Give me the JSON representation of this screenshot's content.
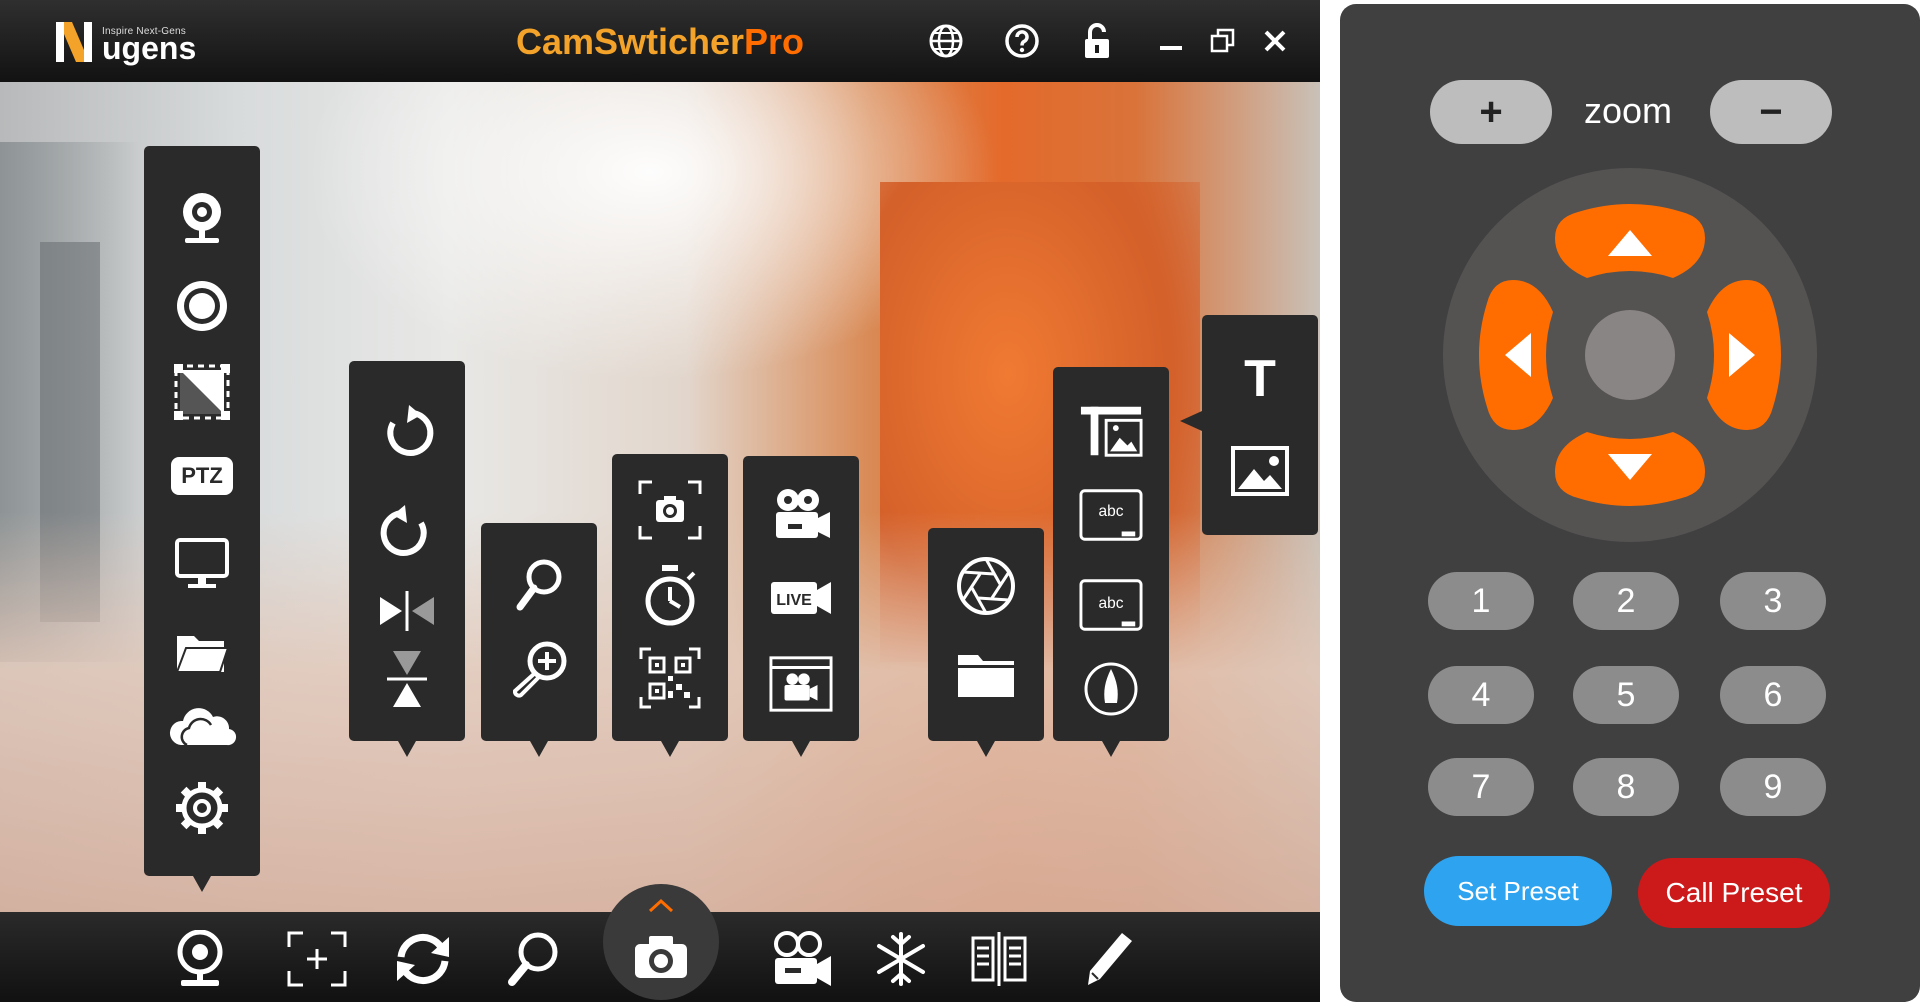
{
  "colors": {
    "title_orange": "#f3a22a",
    "title_pro": "#ff6d00",
    "dpad_orange": "#ff6d00",
    "set_preset_blue": "#2ea4f0",
    "call_preset_red": "#cc1a1a"
  },
  "titlebar": {
    "logo_tagline": "Inspire Next-Gens",
    "logo_word": "ugens",
    "title_main": "CamSwticher",
    "title_pro": "Pro",
    "icons": [
      "globe-icon",
      "help-icon",
      "unlock-icon",
      "minimize-icon",
      "restore-icon",
      "close-icon"
    ]
  },
  "toolbar_camera": {
    "ptz_label": "PTZ",
    "icons": [
      "webcam-icon",
      "lens-icon",
      "crop-icon",
      "ptz-icon",
      "monitor-icon",
      "folder-icon",
      "cloud-icon",
      "gear-icon"
    ]
  },
  "toolbar_rotate": {
    "icons": [
      "rotate-ccw-icon",
      "rotate-cw-icon",
      "flip-horizontal-icon",
      "flip-vertical-icon"
    ]
  },
  "toolbar_zoom": {
    "icons": [
      "magnifier-icon",
      "zoom-in-icon"
    ]
  },
  "toolbar_capture": {
    "icons": [
      "snapshot-icon",
      "timer-icon",
      "qr-code-icon"
    ]
  },
  "toolbar_video": {
    "live_label": "LIVE",
    "icons": [
      "video-camera-icon",
      "live-icon",
      "video-window-icon"
    ]
  },
  "toolbar_files": {
    "icons": [
      "aperture-icon",
      "folder-icon"
    ]
  },
  "toolbar_overlay": {
    "abc_label": "abc",
    "icons": [
      "text-image-icon",
      "text-board-icon",
      "text-board-2-icon",
      "pen-tip-icon"
    ]
  },
  "toolbar_insert": {
    "text_label": "T",
    "icons": [
      "text-icon",
      "image-icon"
    ]
  },
  "bottombar": {
    "icons": [
      "webcam-icon",
      "focus-frame-icon",
      "switch-icon",
      "magnifier-icon",
      "camera-icon",
      "video-camera-icon",
      "snowflake-icon",
      "compare-icon",
      "pencil-icon"
    ]
  },
  "remote": {
    "zoom_label": "zoom",
    "zoom_in": "+",
    "zoom_out": "−",
    "presets": [
      "1",
      "2",
      "3",
      "4",
      "5",
      "6",
      "7",
      "8",
      "9"
    ],
    "set_preset": "Set Preset",
    "call_preset": "Call Preset"
  }
}
